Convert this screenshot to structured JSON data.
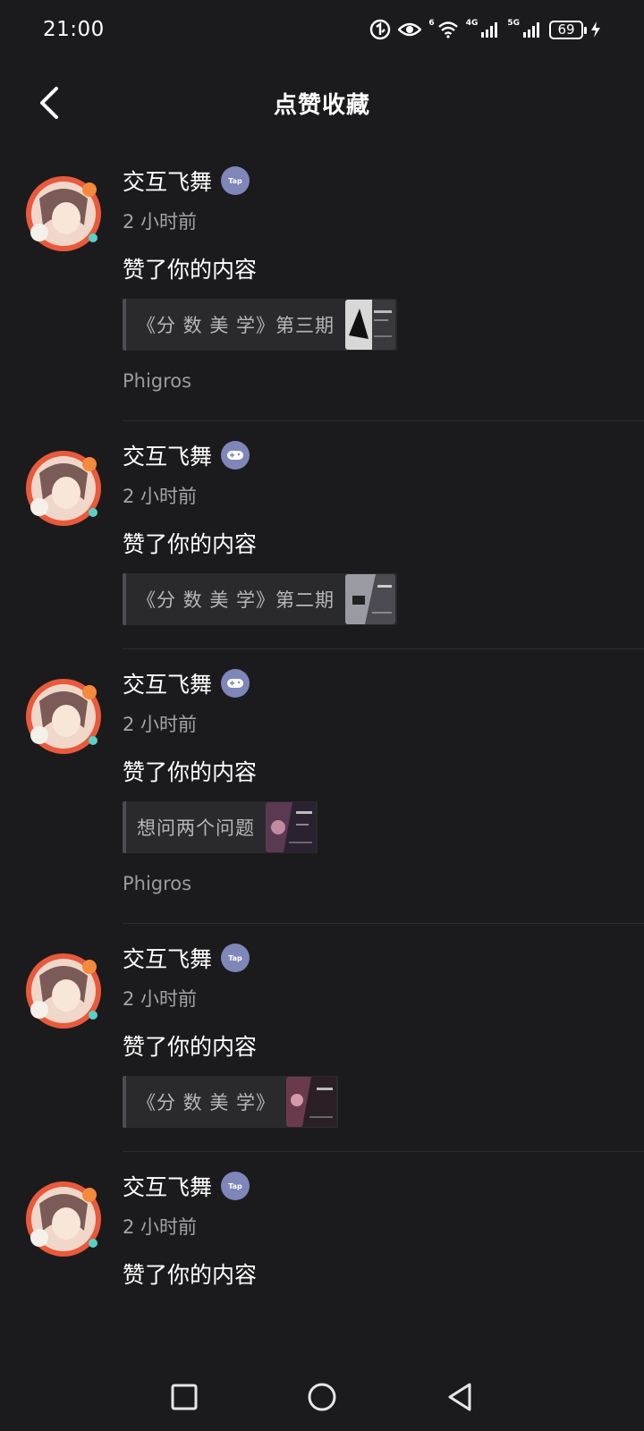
{
  "status_bar": {
    "time": "21:00",
    "battery": "69",
    "net_a": "4G",
    "net_b": "5G",
    "wifi_tag": "6"
  },
  "header": {
    "title": "点赞收藏"
  },
  "tap_badge_text": "Tap",
  "feed": [
    {
      "username": "交互飞舞",
      "time": "2 小时前",
      "action": "赞了你的内容",
      "card": "《分 数 美 学》第三期",
      "game": "Phigros"
    },
    {
      "username": "交互飞舞",
      "time": "2 小时前",
      "action": "赞了你的内容",
      "card": "《分 数 美 学》第二期",
      "game": ""
    },
    {
      "username": "交互飞舞",
      "time": "2 小时前",
      "action": "赞了你的内容",
      "card": "想问两个问题",
      "game": "Phigros"
    },
    {
      "username": "交互飞舞",
      "time": "2 小时前",
      "action": "赞了你的内容",
      "card": "《分 数 美 学》",
      "game": ""
    },
    {
      "username": "交互飞舞",
      "time": "2 小时前",
      "action": "赞了你的内容",
      "card": "",
      "game": ""
    }
  ],
  "colors": {
    "background": "#1b1b1d",
    "badge": "#7f86b8"
  }
}
